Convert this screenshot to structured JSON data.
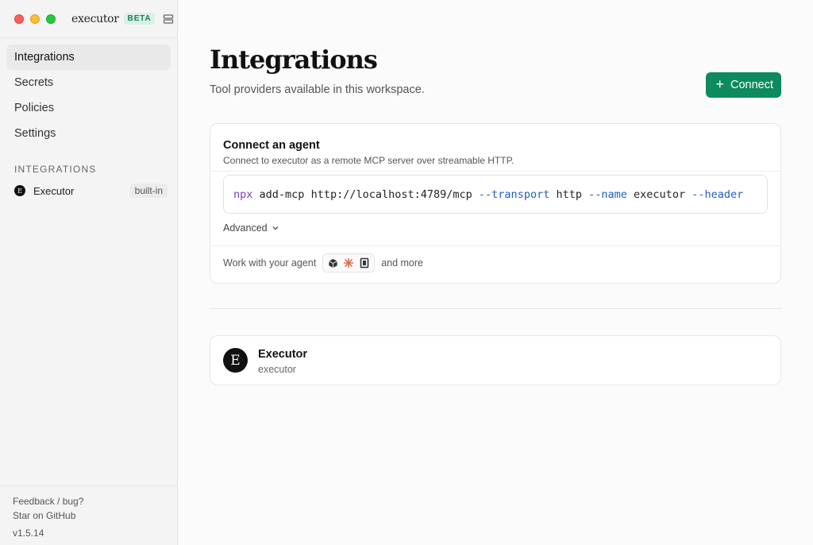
{
  "app": {
    "name": "executor",
    "badge": "BETA"
  },
  "sidebar": {
    "nav": [
      {
        "label": "Integrations",
        "active": true
      },
      {
        "label": "Secrets",
        "active": false
      },
      {
        "label": "Policies",
        "active": false
      },
      {
        "label": "Settings",
        "active": false
      }
    ],
    "section_label": "INTEGRATIONS",
    "integrations": [
      {
        "name": "Executor",
        "tag": "built-in",
        "logo_glyph": "E"
      }
    ],
    "footer": {
      "feedback": "Feedback / bug?",
      "github": "Star on GitHub",
      "version": "v1.5.14"
    }
  },
  "main": {
    "title": "Integrations",
    "subtitle": "Tool providers available in this workspace.",
    "connect_button": "Connect",
    "agent_card": {
      "title": "Connect an agent",
      "description": "Connect to executor as a remote MCP server over streamable HTTP.",
      "command": {
        "cmd": "npx",
        "args": [
          {
            "text": "add-mcp",
            "kind": "arg"
          },
          {
            "text": "http://localhost:4789/mcp",
            "kind": "arg"
          },
          {
            "text": "--transport",
            "kind": "flag"
          },
          {
            "text": "http",
            "kind": "arg"
          },
          {
            "text": "--name",
            "kind": "flag"
          },
          {
            "text": "executor",
            "kind": "arg"
          },
          {
            "text": "--header",
            "kind": "flag"
          }
        ]
      },
      "advanced_label": "Advanced",
      "work_with": "Work with your agent",
      "and_more": "and more"
    },
    "executor_card": {
      "name": "Executor",
      "slug": "executor",
      "logo_glyph": "E"
    }
  },
  "colors": {
    "accent": "#0e8a5f",
    "badge_bg": "#d8f1e4",
    "command_keyword": "#7a3fbf",
    "command_flag": "#1f5fbf"
  }
}
